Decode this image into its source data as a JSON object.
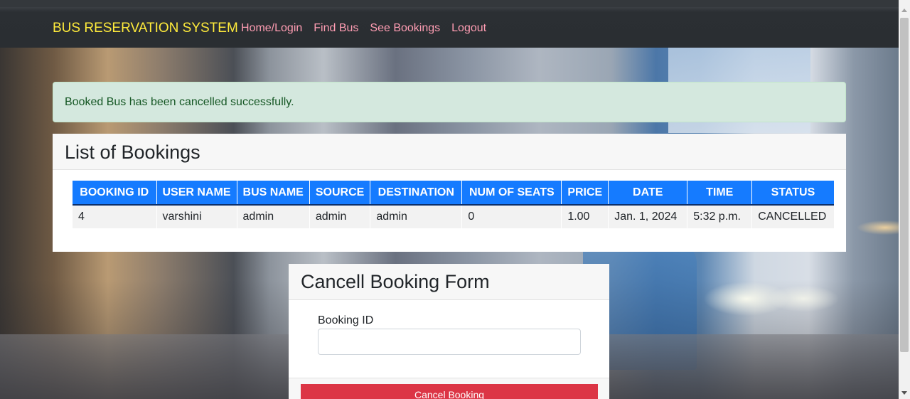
{
  "navbar": {
    "brand": "BUS RESERVATION SYSTEM",
    "links": [
      "Home/Login",
      "Find Bus",
      "See Bookings",
      "Logout"
    ],
    "brand_color": "#ffeb3b",
    "link_color": "#ff9db3"
  },
  "alert": {
    "message": "Booked Bus has been cancelled successfully."
  },
  "bookings": {
    "title": "List of Bookings",
    "columns": [
      "BOOKING ID",
      "USER NAME",
      "BUS NAME",
      "SOURCE",
      "DESTINATION",
      "NUM OF SEATS",
      "PRICE",
      "DATE",
      "TIME",
      "STATUS"
    ],
    "rows": [
      [
        "4",
        "varshini",
        "admin",
        "admin",
        "admin",
        "0",
        "1.00",
        "Jan. 1, 2024",
        "5:32 p.m.",
        "CANCELLED"
      ]
    ],
    "header_color": "#157bff"
  },
  "cancel_form": {
    "title": "Cancell Booking Form",
    "field_label": "Booking ID",
    "field_value": "",
    "button_label": "Cancel Booking",
    "button_color": "#dc3545"
  }
}
